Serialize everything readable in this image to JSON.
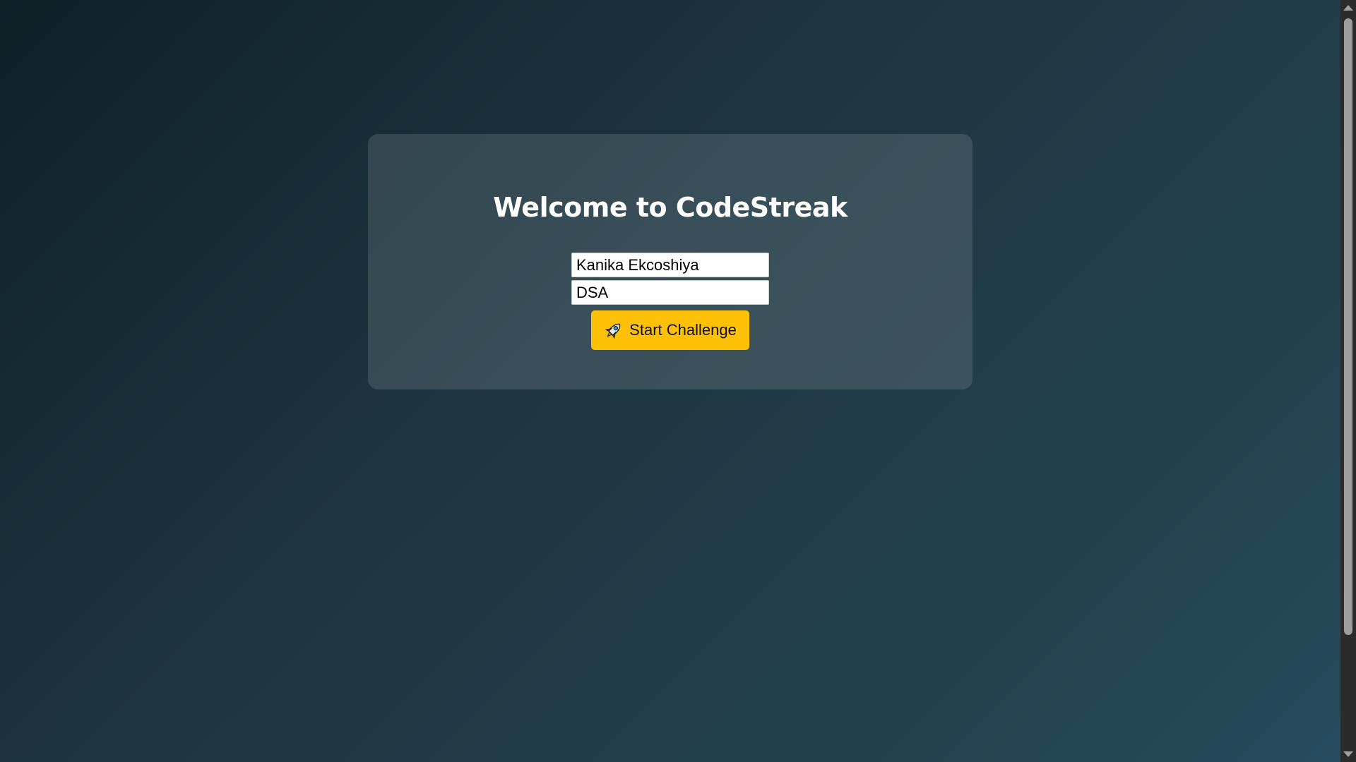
{
  "welcome": {
    "title": "Welcome to CodeStreak"
  },
  "form": {
    "name_value": "Kanika Ekcoshiya",
    "topic_value": "DSA",
    "start_label": "Start Challenge",
    "start_icon": "rocket-icon"
  },
  "colors": {
    "button_accent": "#ffc107",
    "background_start": "#0f2027",
    "background_end": "#274b5e"
  }
}
